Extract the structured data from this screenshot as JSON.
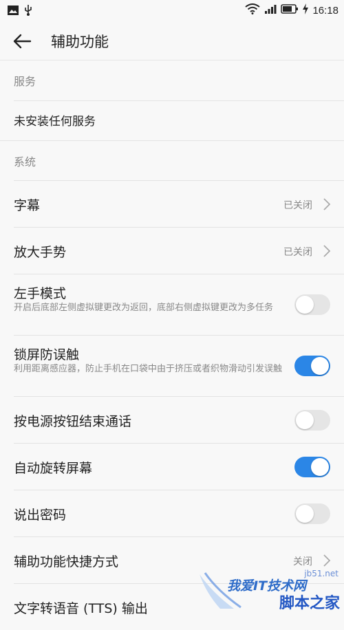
{
  "status_bar": {
    "time": "16:18",
    "left_icons": [
      "image-icon",
      "usb-icon"
    ],
    "right_icons": [
      "wifi-icon",
      "signal-icon",
      "battery-icon",
      "charging-icon"
    ]
  },
  "header": {
    "title": "辅助功能",
    "back_icon": "arrow-left-icon"
  },
  "sections": {
    "services": {
      "header": "服务",
      "empty_item": "未安装任何服务"
    },
    "system": {
      "header": "系统"
    }
  },
  "items": {
    "captions": {
      "label": "字幕",
      "value": "已关闭"
    },
    "magnification": {
      "label": "放大手势",
      "value": "已关闭"
    },
    "left_hand_mode": {
      "label": "左手模式",
      "description": "开启后底部左侧虚拟键更改为返回，底部右侧虚拟键更改为多任务",
      "enabled": false
    },
    "lock_screen_anti_touch": {
      "label": "锁屏防误触",
      "description": "利用距离感应器，防止手机在口袋中由于挤压或者织物滑动引发误触",
      "enabled": true
    },
    "power_button_ends_call": {
      "label": "按电源按钮结束通话",
      "enabled": false
    },
    "auto_rotate": {
      "label": "自动旋转屏幕",
      "enabled": true
    },
    "speak_passwords": {
      "label": "说出密码",
      "enabled": false
    },
    "shortcut": {
      "label": "辅助功能快捷方式",
      "value": "关闭"
    },
    "tts_output": {
      "label": "文字转语音 (TTS) 输出"
    }
  },
  "watermark": {
    "text1": "我爱IT技术网",
    "text2": "脚本之家",
    "text3": "jb51.net"
  },
  "colors": {
    "accent": "#2b86e6",
    "background": "#f8f8f8",
    "divider": "#e3e3e3"
  }
}
